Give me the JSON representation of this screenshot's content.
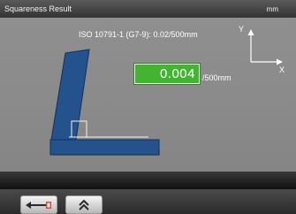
{
  "header": {
    "title": "Squareness Result",
    "unit": "mm"
  },
  "result": {
    "standard": "ISO 10791-1 (G7-9): 0.02/500mm",
    "value": "0.004",
    "per_length": "/500mm",
    "status_color": "#43b431"
  },
  "axes": {
    "x_label": "X",
    "y_label": "Y"
  },
  "diagram": {
    "upright_color": "#23528c",
    "base_color": "#23528c"
  },
  "toolbar": {
    "back_icon": "back-arrow-icon",
    "up_icon": "double-chevron-up-icon"
  }
}
